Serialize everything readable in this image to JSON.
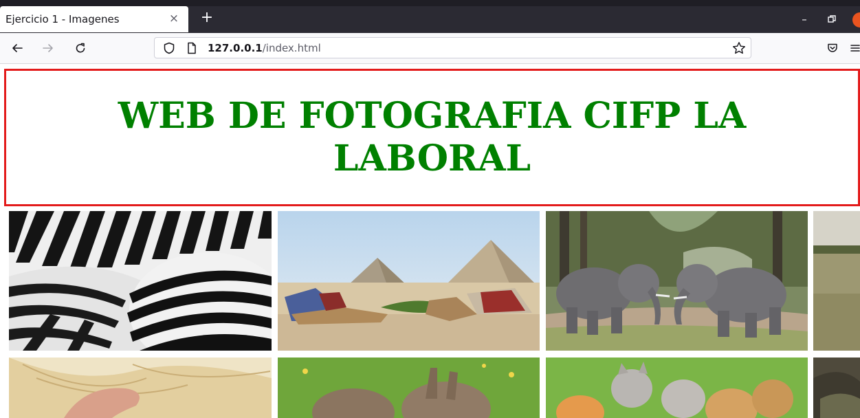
{
  "browser": {
    "tab_title": "Ejercicio 1 - Imagenes",
    "tab_close": "×",
    "new_tab": "+",
    "window_minimize": "–",
    "url_host": "127.0.0.1",
    "url_path": "/index.html"
  },
  "page": {
    "header_title": "WEB DE FOTOGRAFIA CIFP LA LABORAL",
    "border_color": "#e31b1b",
    "title_color": "#008000"
  },
  "icons": {
    "back": "back-arrow-icon",
    "forward": "forward-arrow-icon",
    "reload": "reload-icon",
    "shield": "shield-icon",
    "page": "page-icon",
    "bookmark": "star-icon",
    "pocket": "pocket-icon",
    "menu": "hamburger-menu-icon"
  },
  "gallery": [
    "zebras",
    "pyramids-camels",
    "elephants",
    "savanna",
    "hair",
    "rabbits",
    "kittens",
    "rocks"
  ]
}
